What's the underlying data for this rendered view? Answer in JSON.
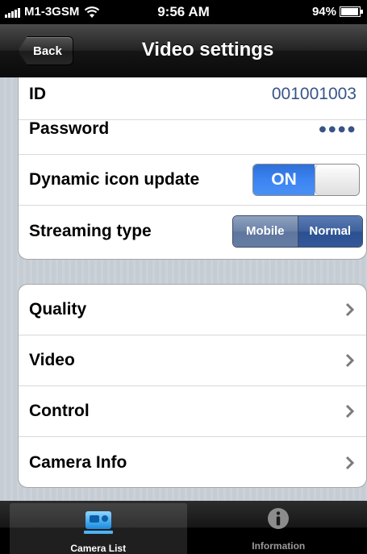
{
  "status_bar": {
    "carrier": "M1-3GSM",
    "time": "9:56 AM",
    "battery": "94%",
    "battery_level": 0.94
  },
  "nav": {
    "back_label": "Back",
    "title": "Video settings"
  },
  "settings": {
    "id_label": "ID",
    "id_value": "001001003",
    "password_label": "Password",
    "password_value": "●●●●",
    "dynamic_icon_label": "Dynamic icon update",
    "dynamic_icon_state": "ON",
    "streaming_label": "Streaming type",
    "streaming_options": [
      "Mobile",
      "Normal"
    ],
    "streaming_selected": "Normal"
  },
  "menu": {
    "items": [
      {
        "label": "Quality"
      },
      {
        "label": "Video"
      },
      {
        "label": "Control"
      },
      {
        "label": "Camera Info"
      }
    ]
  },
  "tabs": [
    {
      "label": "Camera List",
      "icon": "camera-list-icon",
      "selected": true
    },
    {
      "label": "Information",
      "icon": "info-icon",
      "selected": false
    }
  ],
  "colors": {
    "accent_blue": "#385487",
    "toggle_on": "#3b84f2",
    "background": "#c5ccd4"
  }
}
